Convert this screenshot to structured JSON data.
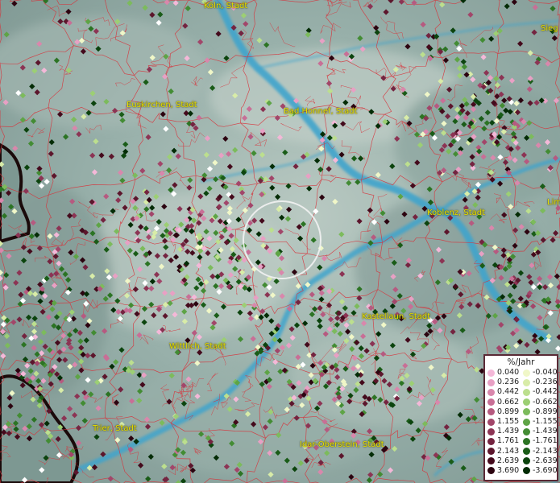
{
  "map": {
    "cities": [
      {
        "name": "Köln, Stadt"
      },
      {
        "name": "Euskirchen, Stadt"
      },
      {
        "name": "Bad Honnef, Stadt"
      },
      {
        "name": "Koblenz, Stadt"
      },
      {
        "name": "Kastellaun, Stadt"
      },
      {
        "name": "Wittlich, Stadt"
      },
      {
        "name": "Trier, Stadt"
      },
      {
        "name": "Idar-Oberstein, Stadt"
      },
      {
        "name": "Sieg"
      },
      {
        "name": "Lim"
      }
    ]
  },
  "legend": {
    "title": "%/Jahr",
    "positive": [
      {
        "value": "0.040",
        "color": "#f4b8d8"
      },
      {
        "value": "0.236",
        "color": "#e8a0c4"
      },
      {
        "value": "0.442",
        "color": "#d987ac"
      },
      {
        "value": "0.662",
        "color": "#c86f96"
      },
      {
        "value": "0.899",
        "color": "#b65a80"
      },
      {
        "value": "1.155",
        "color": "#a2466a"
      },
      {
        "value": "1.439",
        "color": "#8c3454"
      },
      {
        "value": "1.761",
        "color": "#742440"
      },
      {
        "value": "2.143",
        "color": "#5c162c"
      },
      {
        "value": "2.639",
        "color": "#440a1c"
      },
      {
        "value": "3.690",
        "color": "#2c0410"
      }
    ],
    "negative": [
      {
        "value": "-0.040",
        "color": "#f0f7c8"
      },
      {
        "value": "-0.236",
        "color": "#d8eca8"
      },
      {
        "value": "-0.442",
        "color": "#bcdf8e"
      },
      {
        "value": "-0.662",
        "color": "#9ccf74"
      },
      {
        "value": "-0.899",
        "color": "#7cbb5c"
      },
      {
        "value": "-1.155",
        "color": "#5ea446"
      },
      {
        "value": "-1.439",
        "color": "#438c34"
      },
      {
        "value": "-1.761",
        "color": "#2c7424"
      },
      {
        "value": "-2.143",
        "color": "#1a5c18"
      },
      {
        "value": "-2.639",
        "color": "#0c440e"
      },
      {
        "value": "-3.690",
        "color": "#042c06"
      }
    ]
  }
}
